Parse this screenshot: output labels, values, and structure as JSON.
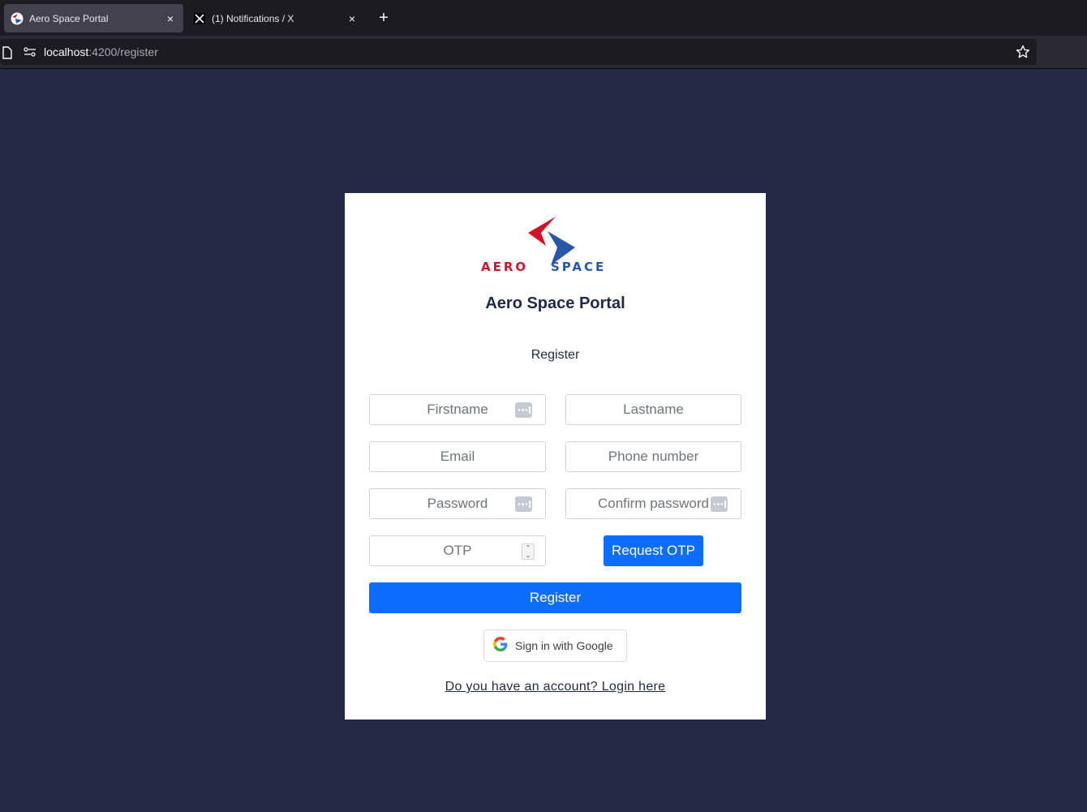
{
  "browser": {
    "tabs": [
      {
        "title": "Aero Space Portal",
        "active": true,
        "favicon": "aerospace-favicon"
      },
      {
        "title": "(1) Notifications / X",
        "active": false,
        "favicon": "x-logo-favicon"
      }
    ],
    "new_tab_label": "+",
    "close_label": "×",
    "url": {
      "host": "localhost",
      "rest": ":4200/register"
    }
  },
  "card": {
    "logo": {
      "left_word": "AERO",
      "right_word": "SPACE",
      "red": "#d0142a",
      "blue": "#2a56a8"
    },
    "title": "Aero Space Portal",
    "subtitle": "Register",
    "fields": {
      "firstname": "Firstname",
      "lastname": "Lastname",
      "email": "Email",
      "phone": "Phone number",
      "password": "Password",
      "confirm_password": "Confirm password",
      "otp": "OTP"
    },
    "request_otp_label": "Request OTP",
    "register_label": "Register",
    "google_label": "Sign in with Google",
    "login_link": "Do you have an account? Login here"
  },
  "colors": {
    "background": "#222a45",
    "primary": "#0d6efd",
    "text": "#1e2a44",
    "placeholder": "#6c757d"
  }
}
